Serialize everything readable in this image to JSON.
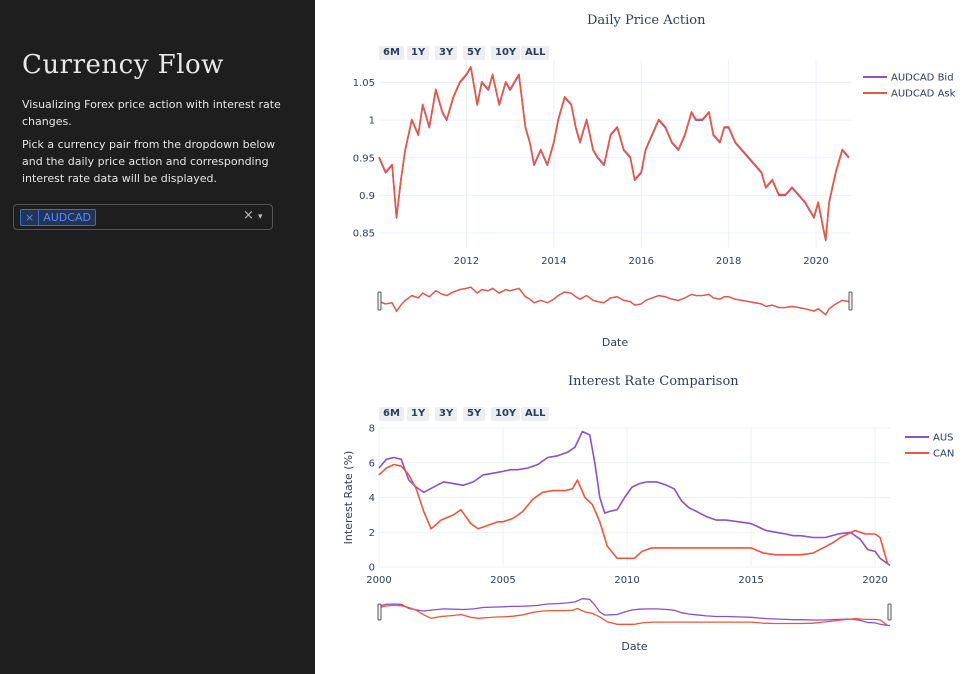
{
  "app": {
    "title": "Currency Flow",
    "description_1": "Visualizing Forex price action with interest rate changes.",
    "description_2": "Pick a currency pair from the dropdown below and the daily price action and corresponding interest rate data will be displayed.",
    "selected_pair": "AUDCAD",
    "chip_remove_symbol": "×",
    "clear_symbol": "×",
    "arrow_symbol": "▾"
  },
  "range_buttons": [
    "6M",
    "1Y",
    "3Y",
    "5Y",
    "10Y",
    "ALL"
  ],
  "colors": {
    "sidebar_bg": "#1e1e1e",
    "chip_accent": "#4d90fe",
    "bid": "#8c4fd0",
    "ask": "#ef553b",
    "aus": "#8c4fd0",
    "can": "#ef553b"
  },
  "chart_data": [
    {
      "type": "line",
      "title": "Daily Price Action",
      "xlabel": "Date",
      "ylabel": "",
      "x_ticks": [
        "2012",
        "2014",
        "2016",
        "2018",
        "2020"
      ],
      "y_ticks": [
        "0.85",
        "0.9",
        "0.95",
        "1",
        "1.05"
      ],
      "xlim": [
        2010.0,
        2020.8
      ],
      "ylim": [
        0.83,
        1.08
      ],
      "legend_position": "top-right",
      "series": [
        {
          "name": "AUDCAD Bid",
          "x": [
            2010.0,
            2010.15,
            2010.3,
            2010.4,
            2010.5,
            2010.6,
            2010.75,
            2010.9,
            2011.0,
            2011.15,
            2011.3,
            2011.45,
            2011.55,
            2011.7,
            2011.85,
            2012.0,
            2012.1,
            2012.25,
            2012.35,
            2012.5,
            2012.6,
            2012.75,
            2012.9,
            2013.0,
            2013.1,
            2013.2,
            2013.35,
            2013.45,
            2013.55,
            2013.7,
            2013.85,
            2014.0,
            2014.1,
            2014.25,
            2014.4,
            2014.5,
            2014.6,
            2014.75,
            2014.9,
            2015.0,
            2015.15,
            2015.3,
            2015.45,
            2015.6,
            2015.75,
            2015.85,
            2016.0,
            2016.1,
            2016.25,
            2016.4,
            2016.55,
            2016.7,
            2016.85,
            2017.0,
            2017.15,
            2017.25,
            2017.4,
            2017.55,
            2017.65,
            2017.8,
            2017.9,
            2018.0,
            2018.15,
            2018.3,
            2018.45,
            2018.6,
            2018.75,
            2018.85,
            2019.0,
            2019.15,
            2019.3,
            2019.45,
            2019.6,
            2019.75,
            2019.85,
            2019.95,
            2020.05,
            2020.15,
            2020.22,
            2020.3,
            2020.45,
            2020.6,
            2020.75
          ],
          "y": [
            0.95,
            0.93,
            0.94,
            0.87,
            0.92,
            0.96,
            1.0,
            0.98,
            1.02,
            0.99,
            1.04,
            1.01,
            1.0,
            1.03,
            1.05,
            1.06,
            1.07,
            1.02,
            1.05,
            1.04,
            1.06,
            1.02,
            1.05,
            1.04,
            1.05,
            1.06,
            0.99,
            0.97,
            0.94,
            0.96,
            0.94,
            0.97,
            1.0,
            1.03,
            1.02,
            0.99,
            0.97,
            1.0,
            0.96,
            0.95,
            0.94,
            0.98,
            0.99,
            0.96,
            0.95,
            0.92,
            0.93,
            0.96,
            0.98,
            1.0,
            0.99,
            0.97,
            0.96,
            0.98,
            1.01,
            1.0,
            1.0,
            1.01,
            0.98,
            0.97,
            0.99,
            0.99,
            0.97,
            0.96,
            0.95,
            0.94,
            0.93,
            0.91,
            0.92,
            0.9,
            0.9,
            0.91,
            0.9,
            0.89,
            0.88,
            0.87,
            0.89,
            0.86,
            0.84,
            0.89,
            0.93,
            0.96,
            0.95
          ]
        },
        {
          "name": "AUDCAD Ask",
          "x": [
            2010.0,
            2010.15,
            2010.3,
            2010.4,
            2010.5,
            2010.6,
            2010.75,
            2010.9,
            2011.0,
            2011.15,
            2011.3,
            2011.45,
            2011.55,
            2011.7,
            2011.85,
            2012.0,
            2012.1,
            2012.25,
            2012.35,
            2012.5,
            2012.6,
            2012.75,
            2012.9,
            2013.0,
            2013.1,
            2013.2,
            2013.35,
            2013.45,
            2013.55,
            2013.7,
            2013.85,
            2014.0,
            2014.1,
            2014.25,
            2014.4,
            2014.5,
            2014.6,
            2014.75,
            2014.9,
            2015.0,
            2015.15,
            2015.3,
            2015.45,
            2015.6,
            2015.75,
            2015.85,
            2016.0,
            2016.1,
            2016.25,
            2016.4,
            2016.55,
            2016.7,
            2016.85,
            2017.0,
            2017.15,
            2017.25,
            2017.4,
            2017.55,
            2017.65,
            2017.8,
            2017.9,
            2018.0,
            2018.15,
            2018.3,
            2018.45,
            2018.6,
            2018.75,
            2018.85,
            2019.0,
            2019.15,
            2019.3,
            2019.45,
            2019.6,
            2019.75,
            2019.85,
            2019.95,
            2020.05,
            2020.15,
            2020.22,
            2020.3,
            2020.45,
            2020.6,
            2020.75
          ],
          "y": [
            0.951,
            0.931,
            0.941,
            0.871,
            0.921,
            0.961,
            1.001,
            0.981,
            1.021,
            0.991,
            1.041,
            1.011,
            1.001,
            1.031,
            1.051,
            1.061,
            1.071,
            1.021,
            1.051,
            1.041,
            1.061,
            1.021,
            1.051,
            1.041,
            1.051,
            1.061,
            0.991,
            0.971,
            0.941,
            0.961,
            0.941,
            0.971,
            1.001,
            1.031,
            1.021,
            0.991,
            0.971,
            1.001,
            0.961,
            0.951,
            0.941,
            0.981,
            0.991,
            0.961,
            0.951,
            0.921,
            0.931,
            0.961,
            0.981,
            1.001,
            0.991,
            0.971,
            0.961,
            0.981,
            1.011,
            1.001,
            1.001,
            1.011,
            0.981,
            0.971,
            0.991,
            0.991,
            0.971,
            0.961,
            0.951,
            0.941,
            0.931,
            0.911,
            0.921,
            0.901,
            0.901,
            0.911,
            0.901,
            0.891,
            0.881,
            0.871,
            0.891,
            0.861,
            0.841,
            0.891,
            0.931,
            0.961,
            0.951
          ]
        }
      ]
    },
    {
      "type": "line",
      "title": "Interest Rate Comparison",
      "xlabel": "Date",
      "ylabel": "Interest Rate (%)",
      "x_ticks": [
        "2000",
        "2005",
        "2010",
        "2015",
        "2020"
      ],
      "y_ticks": [
        "0",
        "2",
        "4",
        "6",
        "8"
      ],
      "xlim": [
        2000,
        2020.6
      ],
      "ylim": [
        0,
        8
      ],
      "legend_position": "top-right",
      "series": [
        {
          "name": "AUS",
          "x": [
            2000,
            2000.3,
            2000.6,
            2000.9,
            2001.2,
            2001.5,
            2001.8,
            2002.2,
            2002.6,
            2003.0,
            2003.4,
            2003.8,
            2004.2,
            2004.6,
            2005.0,
            2005.3,
            2005.6,
            2006.0,
            2006.4,
            2006.8,
            2007.2,
            2007.6,
            2007.9,
            2008.2,
            2008.5,
            2008.7,
            2008.9,
            2009.1,
            2009.3,
            2009.6,
            2009.9,
            2010.2,
            2010.5,
            2010.8,
            2011.2,
            2011.6,
            2011.9,
            2012.2,
            2012.5,
            2012.8,
            2013.2,
            2013.6,
            2014.0,
            2014.5,
            2015.0,
            2015.3,
            2015.6,
            2016.0,
            2016.4,
            2016.7,
            2017.0,
            2017.5,
            2018.0,
            2018.5,
            2019.0,
            2019.4,
            2019.7,
            2020.0,
            2020.2,
            2020.4,
            2020.6
          ],
          "y": [
            5.7,
            6.2,
            6.3,
            6.2,
            5.0,
            4.6,
            4.3,
            4.6,
            4.9,
            4.8,
            4.7,
            4.9,
            5.3,
            5.4,
            5.5,
            5.6,
            5.6,
            5.7,
            5.9,
            6.3,
            6.4,
            6.6,
            6.9,
            7.8,
            7.6,
            6.0,
            4.0,
            3.1,
            3.2,
            3.3,
            4.0,
            4.6,
            4.8,
            4.9,
            4.9,
            4.7,
            4.5,
            3.8,
            3.4,
            3.2,
            2.9,
            2.7,
            2.7,
            2.6,
            2.5,
            2.3,
            2.1,
            2.0,
            1.9,
            1.8,
            1.8,
            1.7,
            1.7,
            1.9,
            2.0,
            1.6,
            1.0,
            0.9,
            0.5,
            0.3,
            0.1
          ]
        },
        {
          "name": "CAN",
          "x": [
            2000,
            2000.3,
            2000.6,
            2000.9,
            2001.2,
            2001.5,
            2001.8,
            2002.1,
            2002.5,
            2003.0,
            2003.3,
            2003.7,
            2004.0,
            2004.4,
            2004.8,
            2005.0,
            2005.4,
            2005.8,
            2006.2,
            2006.6,
            2007.0,
            2007.5,
            2007.8,
            2008.0,
            2008.3,
            2008.6,
            2008.9,
            2009.2,
            2009.6,
            2010.0,
            2010.3,
            2010.6,
            2011.0,
            2012.0,
            2013.0,
            2014.0,
            2015.0,
            2015.5,
            2016.0,
            2016.5,
            2017.0,
            2017.5,
            2017.9,
            2018.3,
            2018.6,
            2018.9,
            2019.2,
            2019.6,
            2020.0,
            2020.2,
            2020.5
          ],
          "y": [
            5.3,
            5.7,
            5.9,
            5.8,
            5.3,
            4.5,
            3.2,
            2.2,
            2.7,
            3.0,
            3.3,
            2.5,
            2.2,
            2.4,
            2.6,
            2.6,
            2.8,
            3.2,
            3.9,
            4.3,
            4.4,
            4.4,
            4.5,
            5.0,
            4.0,
            3.6,
            2.6,
            1.2,
            0.5,
            0.5,
            0.5,
            0.9,
            1.1,
            1.1,
            1.1,
            1.1,
            1.1,
            0.8,
            0.7,
            0.7,
            0.7,
            0.8,
            1.1,
            1.4,
            1.7,
            1.9,
            2.1,
            1.9,
            1.9,
            1.7,
            0.2
          ]
        }
      ]
    }
  ]
}
